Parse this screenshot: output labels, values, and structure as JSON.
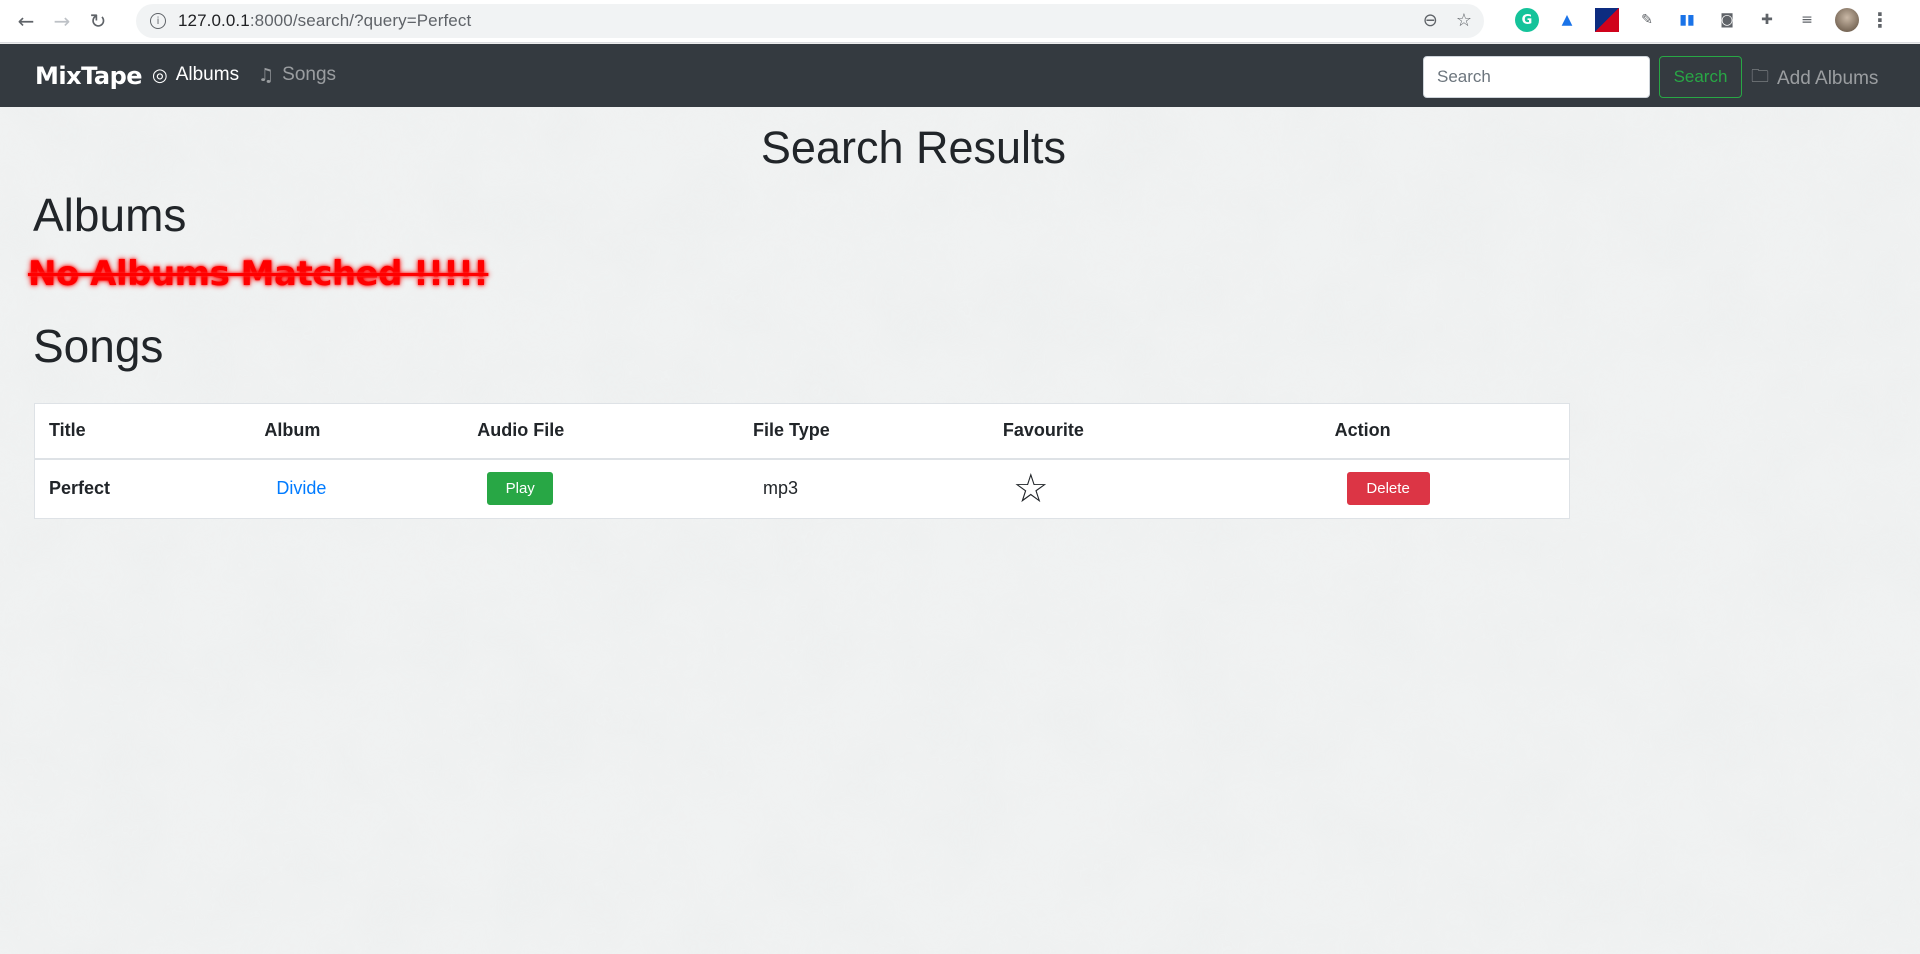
{
  "browser": {
    "url_host": "127.0.0.1",
    "url_rest": ":8000/search/?query=Perfect",
    "extensions": [
      {
        "name": "grammarly-icon",
        "glyph": "G"
      },
      {
        "name": "google-drive-icon",
        "glyph": "▲"
      },
      {
        "name": "flag-extension-icon",
        "glyph": ""
      },
      {
        "name": "eyedropper-icon",
        "glyph": "✎"
      },
      {
        "name": "colorful-extension-icon",
        "glyph": "▮▮"
      },
      {
        "name": "camera-icon",
        "glyph": "◙"
      },
      {
        "name": "puzzle-extensions-icon",
        "glyph": "✚"
      },
      {
        "name": "reading-list-icon",
        "glyph": "≡"
      }
    ]
  },
  "navbar": {
    "brand": "MixTape",
    "albums_label": "Albums",
    "songs_label": "Songs",
    "search_placeholder": "Search",
    "search_button": "Search",
    "add_albums_label": "Add Albums"
  },
  "main": {
    "page_title": "Search Results",
    "albums_heading": "Albums",
    "no_albums_message": "No Albums Matched !!!!!",
    "songs_heading": "Songs",
    "table": {
      "headers": [
        "Title",
        "Album",
        "Audio File",
        "File Type",
        "Favourite",
        "Action"
      ],
      "rows": [
        {
          "title": "Perfect",
          "album": "Divide",
          "audio_button": "Play",
          "file_type": "mp3",
          "favourite": false,
          "action_button": "Delete"
        }
      ]
    }
  },
  "colors": {
    "navbar_bg": "#343a40",
    "success": "#28a745",
    "danger": "#dc3545",
    "link": "#007bff",
    "no_match": "#ff0000"
  }
}
